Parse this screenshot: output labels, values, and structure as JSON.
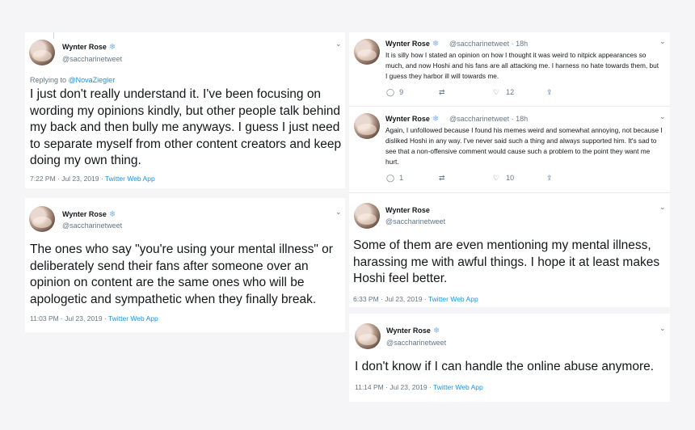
{
  "tweets": [
    {
      "name": "Wynter Rose",
      "badge": "❄",
      "handle": "@saccharinetweet",
      "reply_prefix": "Replying to ",
      "reply_to": "@NovaZiegler",
      "text": "I just don't really understand it. I've been focusing on wording my opinions kindly, but other people talk behind my back and then bully me anyways. I guess I just need to separate myself from other content creators and keep doing my own thing.",
      "time": "7:22 PM · Jul 23, 2019 · ",
      "app": "Twitter Web App"
    },
    {
      "name": "Wynter Rose",
      "badge": "❄",
      "handle": "@saccharinetweet",
      "text": "The ones who say \"you're using your mental illness\" or deliberately send their fans after someone over an opinion on content are the same ones who will be apologetic and sympathetic when they finally break.",
      "time": "11:03 PM · Jul 23, 2019 · ",
      "app": "Twitter Web App"
    },
    {
      "name": "Wynter Rose",
      "badge": "❄",
      "handle": "@saccharinetweet · 18h",
      "text": "It is silly how I stated an opinion on how I thought it was weird to nitpick appearances so much, and now Hoshi and his fans are all attacking me. I harness no hate towards them, but I guess they harbor ill will towards me.",
      "replies": "9",
      "retweets": "",
      "likes": "12"
    },
    {
      "name": "Wynter Rose",
      "badge": "❄",
      "handle": "@saccharinetweet · 18h",
      "text": "Again, I unfollowed because I found his memes weird and somewhat annoying, not because I disliked Hoshi in any way. I've never said such a thing and always supported him. It's sad to see that a non-offensive comment would cause such a problem to the point they want me hurt.",
      "replies": "1",
      "retweets": "",
      "likes": "10"
    },
    {
      "name": "Wynter Rose",
      "badge": "",
      "handle": "@saccharinetweet",
      "text": "Some of them are even mentioning my mental illness, harassing me with awful things. I hope it at least makes Hoshi feel better.",
      "time": "6:33 PM · Jul 23, 2019 · ",
      "app": "Twitter Web App"
    },
    {
      "name": "Wynter Rose",
      "badge": "❄",
      "handle": "@saccharinetweet",
      "text": "I don't know if I can handle the online abuse anymore.",
      "time": "11:14 PM · Jul 23, 2019 · ",
      "app": "Twitter Web App"
    }
  ],
  "icons": {
    "chevron": "⌄",
    "reply": "◯",
    "retweet": "⇄",
    "like": "♡",
    "share": "⇪"
  },
  "colors": {
    "link": "#1b95e0",
    "muted": "#657786",
    "background": "#f5f5f7"
  }
}
